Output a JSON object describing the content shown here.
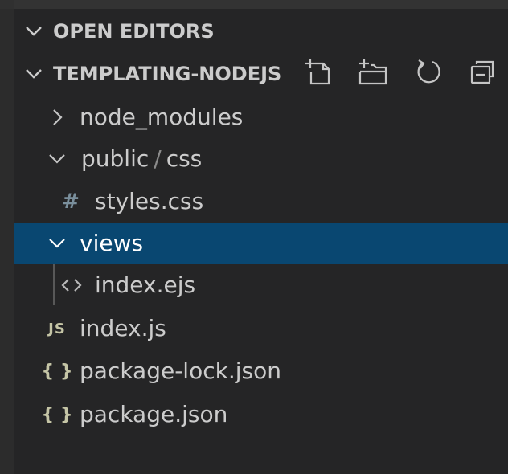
{
  "explorer": {
    "open_editors": {
      "label": "OPEN EDITORS",
      "icon": "chevron-down-icon"
    },
    "project": {
      "label": "TEMPLATING-NODEJS",
      "icon": "chevron-down-icon",
      "actions": [
        {
          "name": "new-file",
          "icon": "new-file-icon"
        },
        {
          "name": "new-folder",
          "icon": "new-folder-icon"
        },
        {
          "name": "refresh",
          "icon": "refresh-icon"
        },
        {
          "name": "collapse-all",
          "icon": "collapse-all-icon"
        }
      ]
    },
    "tree": [
      {
        "label": "node_modules",
        "type": "folder",
        "expanded": false
      },
      {
        "label_parts": [
          "public",
          "/",
          "css"
        ],
        "type": "folder",
        "expanded": true
      },
      {
        "label": "styles.css",
        "type": "file",
        "icon_text": "#",
        "icon_color": "#7a8f9c"
      },
      {
        "label": "views",
        "type": "folder",
        "expanded": true,
        "selected": true
      },
      {
        "label": "index.ejs",
        "type": "file",
        "icon_text": "<>",
        "icon_color": "#b8b8b8"
      },
      {
        "label": "index.js",
        "type": "file",
        "icon_text": "JS",
        "icon_color": "#c5c5a6"
      },
      {
        "label": "package-lock.json",
        "type": "file",
        "icon_text": "{ }",
        "icon_color": "#c5c5a6"
      },
      {
        "label": "package.json",
        "type": "file",
        "icon_text": "{ }",
        "icon_color": "#c5c5a6"
      }
    ]
  },
  "colors": {
    "background": "#252526",
    "selection": "#094771",
    "text": "#cccccc",
    "tree_guide": "#585858"
  }
}
